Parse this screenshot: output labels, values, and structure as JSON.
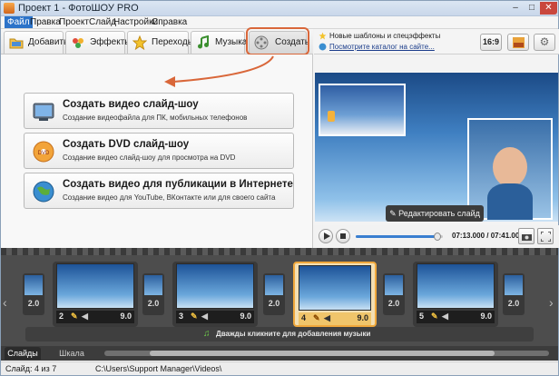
{
  "window": {
    "title": "Проект 1 - ФотоШОУ PRO"
  },
  "menu": [
    {
      "label": "Файл",
      "active": true
    },
    {
      "label": "Правка"
    },
    {
      "label": "Проект"
    },
    {
      "label": "Слайд"
    },
    {
      "label": "Настройки"
    },
    {
      "label": "Справка"
    }
  ],
  "tabs": [
    {
      "label": "Добавить",
      "icon": "folder-icon"
    },
    {
      "label": "Эффекты",
      "icon": "effects-icon"
    },
    {
      "label": "Переходы",
      "icon": "star-icon"
    },
    {
      "label": "Музыка",
      "icon": "music-note-icon"
    },
    {
      "label": "Создать",
      "icon": "film-reel-icon"
    }
  ],
  "actions": [
    {
      "title": "Создать видео слайд-шоу",
      "desc": "Создание видеофайла для ПК, мобильных телефонов",
      "icon": "video-device-icon"
    },
    {
      "title": "Создать DVD слайд-шоу",
      "desc": "Создание видео слайд-шоу для просмотра на DVD",
      "icon": "dvd-icon"
    },
    {
      "title": "Создать видео для публикации в Интернете",
      "desc": "Создание видео для YouTube, ВКонтакте или для своего сайта",
      "icon": "globe-icon"
    }
  ],
  "news": {
    "line1": "Новые шаблоны и спецэффекты",
    "line2": "Посмотрите каталог на сайте..."
  },
  "aspect_label": "16:9",
  "edit_slide_label": "Редактировать слайд",
  "player": {
    "time": "07:13.000 / 07:41.000",
    "progress": 0.94
  },
  "slides": [
    {
      "num": "2",
      "dur": "9.0"
    },
    {
      "num": "3",
      "dur": "9.0"
    },
    {
      "num": "4",
      "dur": "9.0",
      "selected": true
    },
    {
      "num": "5",
      "dur": "9.0"
    }
  ],
  "transitions": [
    "2.0",
    "2.0",
    "2.0",
    "2.0",
    "2.0"
  ],
  "music_hint": "Дважды кликните для добавления музыки",
  "bottom_tabs": [
    {
      "label": "Слайды",
      "active": true
    },
    {
      "label": "Шкала времени"
    }
  ],
  "status": {
    "slide": "Слайд: 4 из 7",
    "path": "C:\\Users\\Support Manager\\Videos\\"
  },
  "colors": {
    "accent": "#d9673a",
    "selected_slide": "#f0a83c",
    "menu_active": "#2c73c9"
  }
}
